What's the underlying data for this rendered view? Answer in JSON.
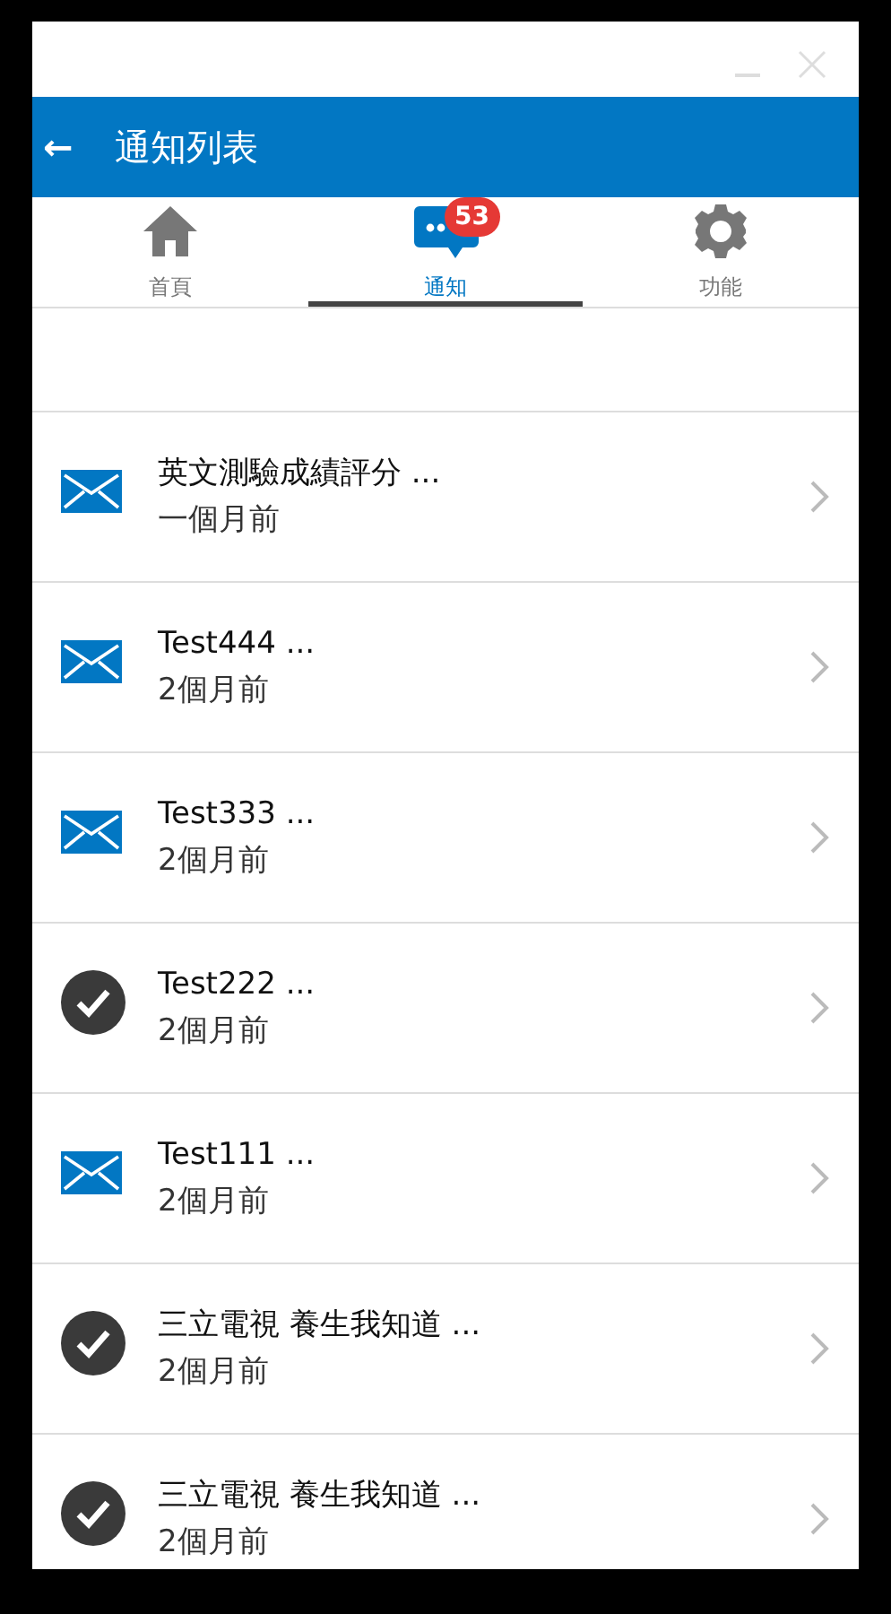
{
  "header": {
    "back": "←",
    "title": "通知列表"
  },
  "tabs": [
    {
      "label": "首頁",
      "kind": "home",
      "selected": false
    },
    {
      "label": "通知",
      "kind": "chat",
      "selected": true,
      "badge": "53"
    },
    {
      "label": "功能",
      "kind": "gear",
      "selected": false
    }
  ],
  "notifications": [
    {
      "title": "英文測驗成績評分 ...",
      "time": "一個月前",
      "read": false
    },
    {
      "title": "Test444 ...",
      "time": "2個月前",
      "read": false
    },
    {
      "title": "Test333 ...",
      "time": "2個月前",
      "read": false
    },
    {
      "title": "Test222 ...",
      "time": "2個月前",
      "read": true
    },
    {
      "title": "Test111 ...",
      "time": "2個月前",
      "read": false
    },
    {
      "title": "三立電視 養生我知道 ...",
      "time": "2個月前",
      "read": true
    },
    {
      "title": "三立電視 養生我知道 ...",
      "time": "2個月前",
      "read": true
    }
  ]
}
